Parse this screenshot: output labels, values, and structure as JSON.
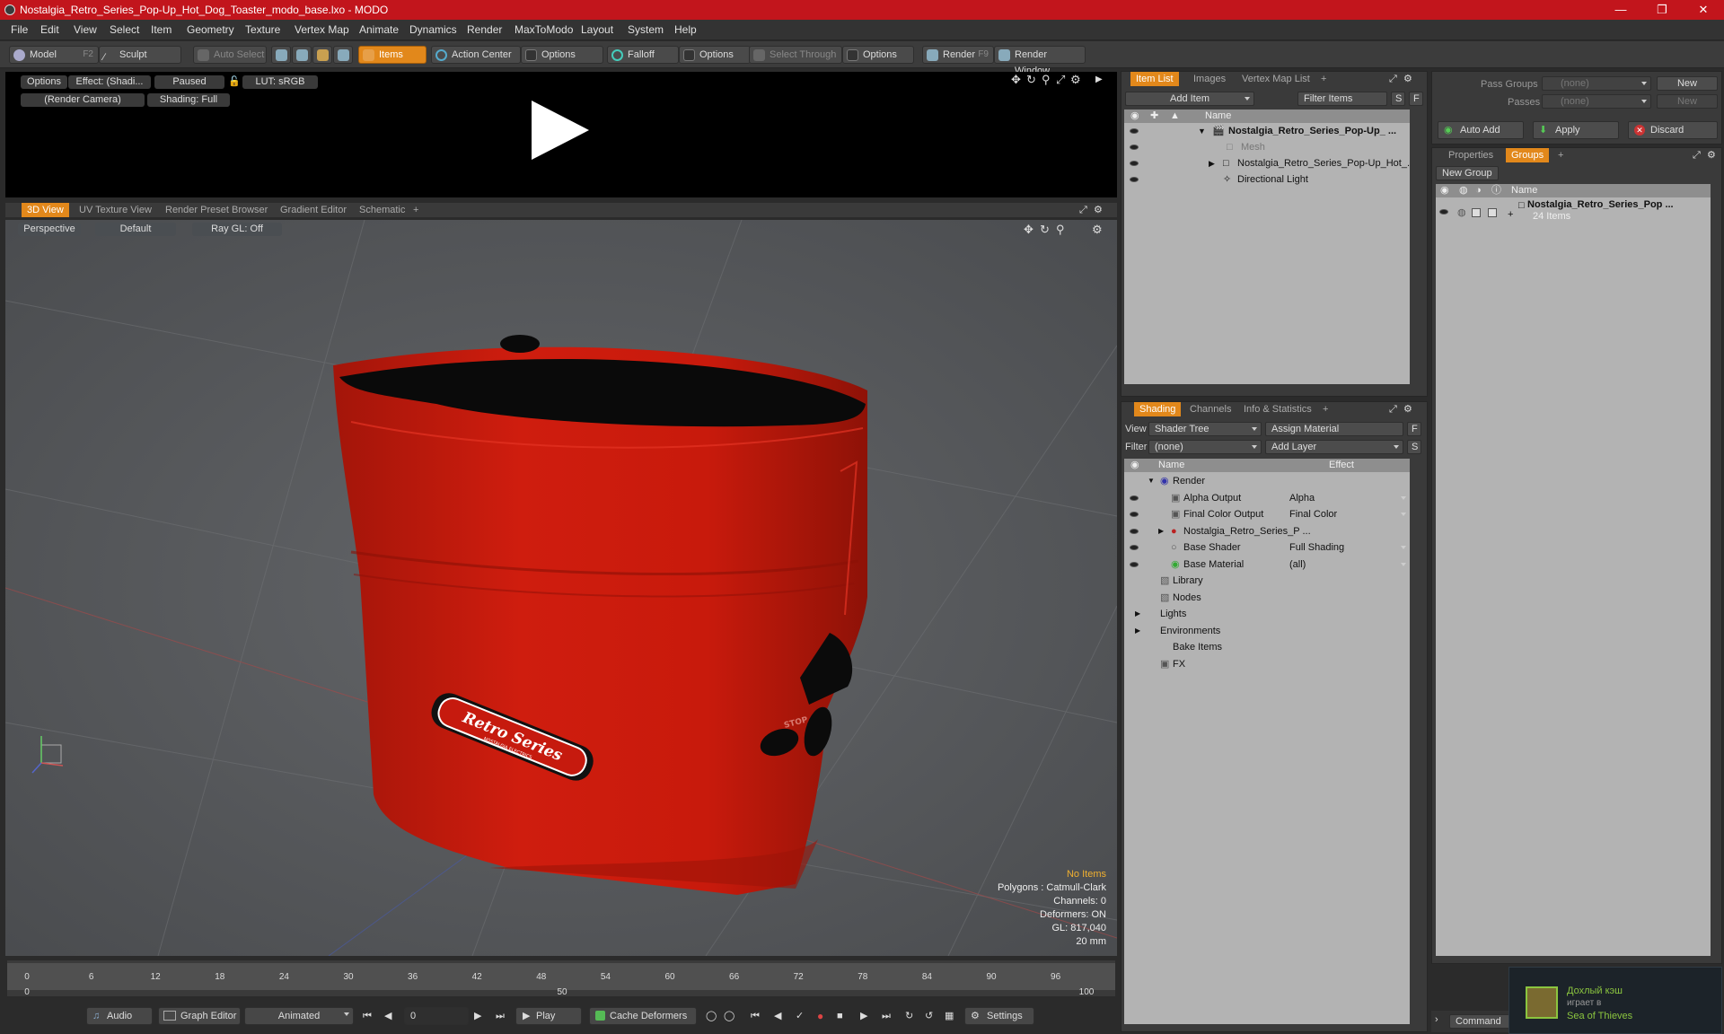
{
  "window": {
    "title": "Nostalgia_Retro_Series_Pop-Up_Hot_Dog_Toaster_modo_base.lxo - MODO"
  },
  "menu": [
    "File",
    "Edit",
    "View",
    "Select",
    "Item",
    "Geometry",
    "Texture",
    "Vertex Map",
    "Animate",
    "Dynamics",
    "Render",
    "MaxToModo",
    "Layout",
    "System",
    "Help"
  ],
  "toolbar": {
    "model": "Model",
    "model_hotkey": "F2",
    "sculpt": "Sculpt",
    "auto_select": "Auto Select",
    "items": "Items",
    "action_center": "Action Center",
    "options1": "Options",
    "falloff": "Falloff",
    "options2": "Options",
    "select_through": "Select Through",
    "options3": "Options",
    "render": "Render",
    "render_hotkey": "F9",
    "render_window": "Render Window"
  },
  "render_preview": {
    "options": "Options",
    "effect": "Effect: (Shadi...",
    "paused": "Paused",
    "lut": "LUT: sRGB",
    "camera": "(Render Camera)",
    "shading": "Shading: Full"
  },
  "viewport_tabs": [
    "3D View",
    "UV Texture View",
    "Render Preset Browser",
    "Gradient Editor",
    "Schematic"
  ],
  "viewport": {
    "projection": "Perspective",
    "style": "Default",
    "raygl": "Ray GL: Off",
    "stats": {
      "no_items": "No Items",
      "polygons": "Polygons : Catmull-Clark",
      "channels": "Channels: 0",
      "deformers": "Deformers: ON",
      "gl": "GL: 817,040",
      "scale": "20 mm"
    },
    "model_label": "Retro Series",
    "model_sublabel": "NOSTALGIA ELECTRICS",
    "stop_label": "STOP"
  },
  "timeline": {
    "ticks": [
      "0",
      "6",
      "12",
      "18",
      "24",
      "30",
      "36",
      "42",
      "48",
      "54",
      "60",
      "66",
      "72",
      "78",
      "84",
      "90",
      "96"
    ],
    "start": "0",
    "mid": "50",
    "end": "100"
  },
  "bottom": {
    "audio": "Audio",
    "graph_editor": "Graph Editor",
    "animated": "Animated",
    "frame": "0",
    "play": "Play",
    "cache": "Cache Deformers",
    "settings": "Settings"
  },
  "item_list": {
    "tabs": [
      "Item List",
      "Images",
      "Vertex Map List"
    ],
    "add_item": "Add Item",
    "filter": "Filter Items",
    "s": "S",
    "f": "F",
    "col_name": "Name",
    "rows": [
      "Nostalgia_Retro_Series_Pop-Up_ ...",
      "Mesh",
      "Nostalgia_Retro_Series_Pop-Up_Hot_...",
      "Directional Light"
    ]
  },
  "shading": {
    "tabs": [
      "Shading",
      "Channels",
      "Info & Statistics"
    ],
    "view_label": "View",
    "view_value": "Shader Tree",
    "assign": "Assign Material",
    "filter_label": "Filter",
    "filter_value": "(none)",
    "add_layer": "Add Layer",
    "f": "F",
    "s": "S",
    "col_name": "Name",
    "col_effect": "Effect",
    "rows": [
      {
        "name": "Render",
        "effect": ""
      },
      {
        "name": "Alpha Output",
        "effect": "Alpha"
      },
      {
        "name": "Final Color Output",
        "effect": "Final Color"
      },
      {
        "name": "Nostalgia_Retro_Series_P ...",
        "effect": ""
      },
      {
        "name": "Base Shader",
        "effect": "Full Shading"
      },
      {
        "name": "Base Material",
        "effect": "(all)"
      },
      {
        "name": "Library",
        "effect": ""
      },
      {
        "name": "Nodes",
        "effect": ""
      },
      {
        "name": "Lights",
        "effect": ""
      },
      {
        "name": "Environments",
        "effect": ""
      },
      {
        "name": "Bake Items",
        "effect": ""
      },
      {
        "name": "FX",
        "effect": ""
      }
    ]
  },
  "passes": {
    "pass_groups": "Pass Groups",
    "passes": "Passes",
    "none1": "(none)",
    "none2": "(none)",
    "new1": "New",
    "new2": "New",
    "auto_add": "Auto Add",
    "apply": "Apply",
    "discard": "Discard"
  },
  "groups": {
    "tabs": [
      "Properties",
      "Groups"
    ],
    "new_group": "New Group",
    "col_name": "Name",
    "row_name": "Nostalgia_Retro_Series_Pop ...",
    "row_count": "24 Items"
  },
  "command": {
    "label": "Command"
  },
  "steam": {
    "line1": "Дохлый кэш",
    "line2": "играет в",
    "line3": "Sea of Thieves"
  },
  "colors": {
    "accent": "#e2881b",
    "title": "#c2151c",
    "toaster": "#c61a0e"
  }
}
